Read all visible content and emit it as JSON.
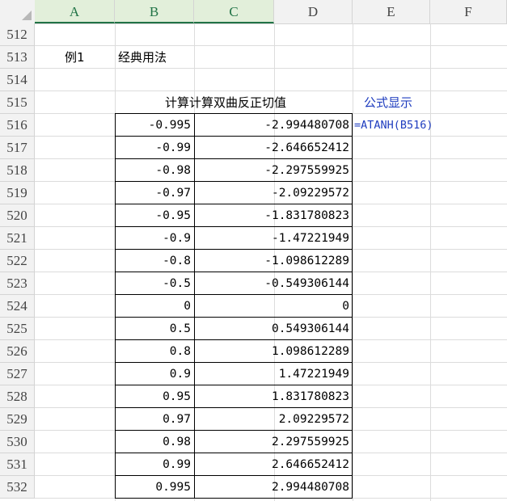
{
  "columns": [
    "A",
    "B",
    "C",
    "D",
    "E",
    "F"
  ],
  "row_numbers": [
    "512",
    "513",
    "514",
    "515",
    "516",
    "517",
    "518",
    "519",
    "520",
    "521",
    "522",
    "523",
    "524",
    "525",
    "526",
    "527",
    "528",
    "529",
    "530",
    "531",
    "532"
  ],
  "example_label": "例1",
  "example_title": "经典用法",
  "table_header": "计算计算双曲反正切值",
  "formula_header": "公式显示",
  "formula_text": "=ATANH(B516)",
  "rows": [
    {
      "x": "-0.995",
      "atanh": "-2.994480708"
    },
    {
      "x": "-0.99",
      "atanh": "-2.646652412"
    },
    {
      "x": "-0.98",
      "atanh": "-2.297559925"
    },
    {
      "x": "-0.97",
      "atanh": "-2.09229572"
    },
    {
      "x": "-0.95",
      "atanh": "-1.831780823"
    },
    {
      "x": "-0.9",
      "atanh": "-1.47221949"
    },
    {
      "x": "-0.8",
      "atanh": "-1.098612289"
    },
    {
      "x": "-0.5",
      "atanh": "-0.549306144"
    },
    {
      "x": "0",
      "atanh": "0"
    },
    {
      "x": "0.5",
      "atanh": "0.549306144"
    },
    {
      "x": "0.8",
      "atanh": "1.098612289"
    },
    {
      "x": "0.9",
      "atanh": "1.47221949"
    },
    {
      "x": "0.95",
      "atanh": "1.831780823"
    },
    {
      "x": "0.97",
      "atanh": "2.09229572"
    },
    {
      "x": "0.98",
      "atanh": "2.297559925"
    },
    {
      "x": "0.99",
      "atanh": "2.646652412"
    },
    {
      "x": "0.995",
      "atanh": "2.994480708"
    }
  ],
  "colors": {
    "header_bg": "#f2f2f2",
    "selected_col_bg": "#e2efda",
    "accent": "#217346",
    "formula_blue": "#1f3dbf"
  }
}
